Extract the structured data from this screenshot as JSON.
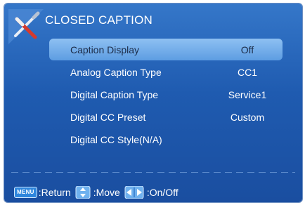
{
  "header": {
    "icon": "tools-icon",
    "title": "CLOSED CAPTION"
  },
  "menu": {
    "selected_index": 0,
    "items": [
      {
        "label": "Caption Display",
        "value": "Off"
      },
      {
        "label": "Analog Caption Type",
        "value": "CC1"
      },
      {
        "label": "Digital Caption Type",
        "value": "Service1"
      },
      {
        "label": "Digital CC Preset",
        "value": "Custom"
      },
      {
        "label": "Digital CC Style(N/A)",
        "value": ""
      }
    ]
  },
  "footer": {
    "menu_key_label": "MENU",
    "return_hint": ":Return",
    "move_icon": "up-down-arrows-icon",
    "move_hint": ":Move",
    "onoff_icon": "left-right-arrows-icon",
    "onoff_hint": ":On/Off"
  },
  "colors": {
    "panel_top": "#3577c9",
    "panel_bottom": "#1a4ea0",
    "selection": "#7db3ec",
    "text": "#ffffff",
    "selected_text": "#1b2b47"
  }
}
